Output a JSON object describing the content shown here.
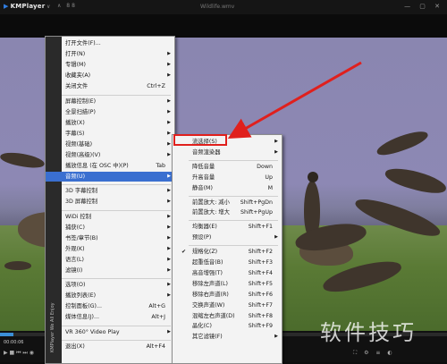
{
  "titlebar": {
    "logo": "KMPlayer",
    "version": "∨",
    "mini": "∧ 88",
    "file": "Wildlife.wmv",
    "controls": "— ▢ ✕"
  },
  "player": {
    "time": "00:00:06",
    "progress": 0.03,
    "side_brand": "KMPlayer",
    "left_controls": "▶ ■ ⏮ ⏭ ◉",
    "right_controls": "⛶ ⚙ ≡ ◐"
  },
  "main_menu": [
    {
      "label": "打开文件(F)...",
      "shortcut": "",
      "arrow": false
    },
    {
      "label": "打开(N)",
      "shortcut": "",
      "arrow": true
    },
    {
      "label": "专辑(M)",
      "shortcut": "",
      "arrow": true
    },
    {
      "label": "收藏夹(A)",
      "shortcut": "",
      "arrow": true
    },
    {
      "label": "关闭文件",
      "shortcut": "Ctrl+Z",
      "arrow": false,
      "sep_after": true
    },
    {
      "label": "屏幕控制(E)",
      "shortcut": "",
      "arrow": true
    },
    {
      "label": "全景扫描(P)",
      "shortcut": "",
      "arrow": true
    },
    {
      "label": "播放(X)",
      "shortcut": "",
      "arrow": true
    },
    {
      "label": "字幕(S)",
      "shortcut": "",
      "arrow": true
    },
    {
      "label": "视频(基础)",
      "shortcut": "",
      "arrow": true
    },
    {
      "label": "视频(高级)(V)",
      "shortcut": "",
      "arrow": true
    },
    {
      "label": "播放信息 (在 OSC 中)(P)",
      "shortcut": "Tab",
      "arrow": false
    },
    {
      "label": "音频(U)",
      "shortcut": "",
      "arrow": true,
      "highlight": true,
      "sep_after": true
    },
    {
      "label": "3D 字幕控制",
      "shortcut": "",
      "arrow": true
    },
    {
      "label": "3D 屏幕控制",
      "shortcut": "",
      "arrow": true,
      "sep_after": true
    },
    {
      "label": "WiDi 控制",
      "shortcut": "",
      "arrow": true
    },
    {
      "label": "捕获(C)",
      "shortcut": "",
      "arrow": true
    },
    {
      "label": "书签/章节(B)",
      "shortcut": "",
      "arrow": true
    },
    {
      "label": "外观(K)",
      "shortcut": "",
      "arrow": true
    },
    {
      "label": "语言(L)",
      "shortcut": "",
      "arrow": true
    },
    {
      "label": "滤镜(I)",
      "shortcut": "",
      "arrow": true,
      "sep_after": true
    },
    {
      "label": "选项(O)",
      "shortcut": "",
      "arrow": true
    },
    {
      "label": "播放列表(E)",
      "shortcut": "",
      "arrow": true
    },
    {
      "label": "控制面板(G)...",
      "shortcut": "Alt+G",
      "arrow": false
    },
    {
      "label": "媒体信息(J)...",
      "shortcut": "Alt+J",
      "arrow": false,
      "sep_after": true
    },
    {
      "label": "VR 360° Video Play",
      "shortcut": "",
      "arrow": true,
      "sep_after": true
    },
    {
      "label": "退出(X)",
      "shortcut": "Alt+F4",
      "arrow": false
    }
  ],
  "main_menu_strip": "KMPlayer We All Enjoy",
  "audio_menu": [
    {
      "label": "流选择(S)",
      "shortcut": "",
      "arrow": true,
      "boxed": true
    },
    {
      "label": "音频渲染器",
      "shortcut": "",
      "arrow": true,
      "sep_after": true
    },
    {
      "label": "降低音量",
      "shortcut": "Down",
      "arrow": false
    },
    {
      "label": "升高音量",
      "shortcut": "Up",
      "arrow": false
    },
    {
      "label": "静音(M)",
      "shortcut": "M",
      "arrow": false,
      "sep_after": true
    },
    {
      "label": "前置放大: 减小",
      "shortcut": "Shift+PgDn",
      "arrow": false
    },
    {
      "label": "前置放大: 增大",
      "shortcut": "Shift+PgUp",
      "arrow": false,
      "sep_after": true
    },
    {
      "label": "均衡器(E)",
      "shortcut": "Shift+F1",
      "arrow": false
    },
    {
      "label": "预设(P)",
      "shortcut": "",
      "arrow": true,
      "sep_after": true
    },
    {
      "label": "规格化(Z)",
      "shortcut": "Shift+F2",
      "arrow": false,
      "checked": true
    },
    {
      "label": "超重低音(B)",
      "shortcut": "Shift+F3",
      "arrow": false
    },
    {
      "label": "高音增强(T)",
      "shortcut": "Shift+F4",
      "arrow": false
    },
    {
      "label": "移除左声道(L)",
      "shortcut": "Shift+F5",
      "arrow": false
    },
    {
      "label": "移除右声道(R)",
      "shortcut": "Shift+F6",
      "arrow": false
    },
    {
      "label": "交换声道(W)",
      "shortcut": "Shift+F7",
      "arrow": false
    },
    {
      "label": "混缩左右声道(D)",
      "shortcut": "Shift+F8",
      "arrow": false
    },
    {
      "label": "晶化(C)",
      "shortcut": "Shift+F9",
      "arrow": false
    },
    {
      "label": "其它滤镜(F)",
      "shortcut": "",
      "arrow": true
    }
  ],
  "watermark": "软件技巧",
  "colors": {
    "highlight": "#3a6fd0",
    "annotation": "#e0201d"
  }
}
